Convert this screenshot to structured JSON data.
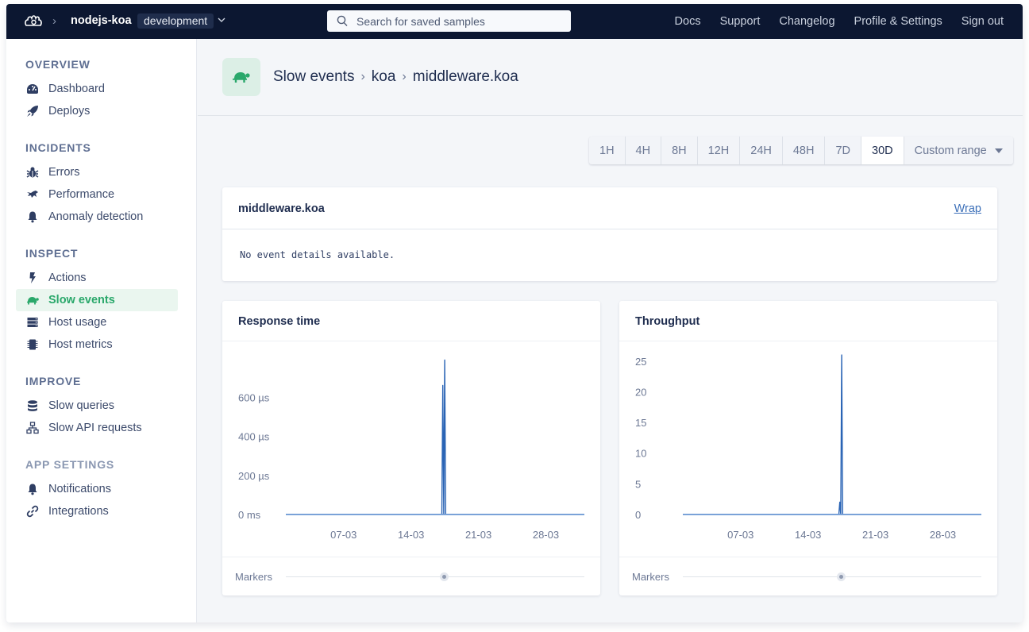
{
  "topbar": {
    "app_name": "nodejs-koa",
    "environment": "development",
    "search_placeholder": "Search for saved samples",
    "search_value": "",
    "nav": [
      "Docs",
      "Support",
      "Changelog",
      "Profile & Settings",
      "Sign out"
    ]
  },
  "sidebar": {
    "sections": [
      {
        "title": "OVERVIEW",
        "items": [
          {
            "label": "Dashboard",
            "icon": "dashboard-icon"
          },
          {
            "label": "Deploys",
            "icon": "rocket-icon"
          }
        ]
      },
      {
        "title": "INCIDENTS",
        "items": [
          {
            "label": "Errors",
            "icon": "bug-icon"
          },
          {
            "label": "Performance",
            "icon": "performance-icon"
          },
          {
            "label": "Anomaly detection",
            "icon": "bell-icon"
          }
        ]
      },
      {
        "title": "INSPECT",
        "items": [
          {
            "label": "Actions",
            "icon": "bolt-icon"
          },
          {
            "label": "Slow events",
            "icon": "turtle-icon",
            "active": true
          },
          {
            "label": "Host usage",
            "icon": "server-icon"
          },
          {
            "label": "Host metrics",
            "icon": "chip-icon"
          }
        ]
      },
      {
        "title": "IMPROVE",
        "items": [
          {
            "label": "Slow queries",
            "icon": "database-icon"
          },
          {
            "label": "Slow API requests",
            "icon": "network-icon"
          }
        ]
      },
      {
        "title": "APP SETTINGS",
        "items": [
          {
            "label": "Notifications",
            "icon": "bell-icon"
          },
          {
            "label": "Integrations",
            "icon": "link-icon"
          }
        ]
      }
    ]
  },
  "header": {
    "breadcrumb": [
      "Slow events",
      "koa",
      "middleware.koa"
    ],
    "accent": "#2aa86b"
  },
  "time_range": {
    "options": [
      "1H",
      "4H",
      "8H",
      "12H",
      "24H",
      "48H",
      "7D",
      "30D"
    ],
    "selected": "30D",
    "custom_label": "Custom range"
  },
  "event_card": {
    "title": "middleware.koa",
    "wrap_label": "Wrap",
    "body": "No event details available."
  },
  "markers_label": "Markers",
  "chart_data": [
    {
      "type": "line",
      "title": "Response time",
      "xlabel": "",
      "ylabel": "",
      "x_ticks": [
        "07-03",
        "14-03",
        "21-03",
        "28-03"
      ],
      "x_range_days": [
        1,
        32
      ],
      "y_ticks": [
        "0 ms",
        "200 µs",
        "400 µs",
        "600 µs"
      ],
      "y_tick_values": [
        0,
        200,
        400,
        600
      ],
      "ylim": [
        0,
        800
      ],
      "unit": "µs",
      "series": [
        {
          "name": "Response time",
          "color": "#2a64b5",
          "points": [
            [
              1,
              0
            ],
            [
              17.2,
              0
            ],
            [
              17.3,
              660
            ],
            [
              17.4,
              0
            ],
            [
              17.5,
              790
            ],
            [
              17.6,
              0
            ],
            [
              32,
              0
            ]
          ]
        }
      ],
      "grid": false,
      "markers_position": 0.53
    },
    {
      "type": "line",
      "title": "Throughput",
      "xlabel": "",
      "ylabel": "",
      "x_ticks": [
        "07-03",
        "14-03",
        "21-03",
        "28-03"
      ],
      "x_range_days": [
        1,
        32
      ],
      "y_ticks": [
        "0",
        "5",
        "10",
        "15",
        "20",
        "25"
      ],
      "y_tick_values": [
        0,
        5,
        10,
        15,
        20,
        25
      ],
      "ylim": [
        0,
        25.5
      ],
      "series": [
        {
          "name": "Throughput",
          "color": "#2a64b5",
          "points": [
            [
              1,
              0
            ],
            [
              17.2,
              0
            ],
            [
              17.3,
              2
            ],
            [
              17.4,
              0
            ],
            [
              17.5,
              26
            ],
            [
              17.6,
              0
            ],
            [
              32,
              0
            ]
          ]
        }
      ],
      "grid": false,
      "markers_position": 0.53
    }
  ]
}
